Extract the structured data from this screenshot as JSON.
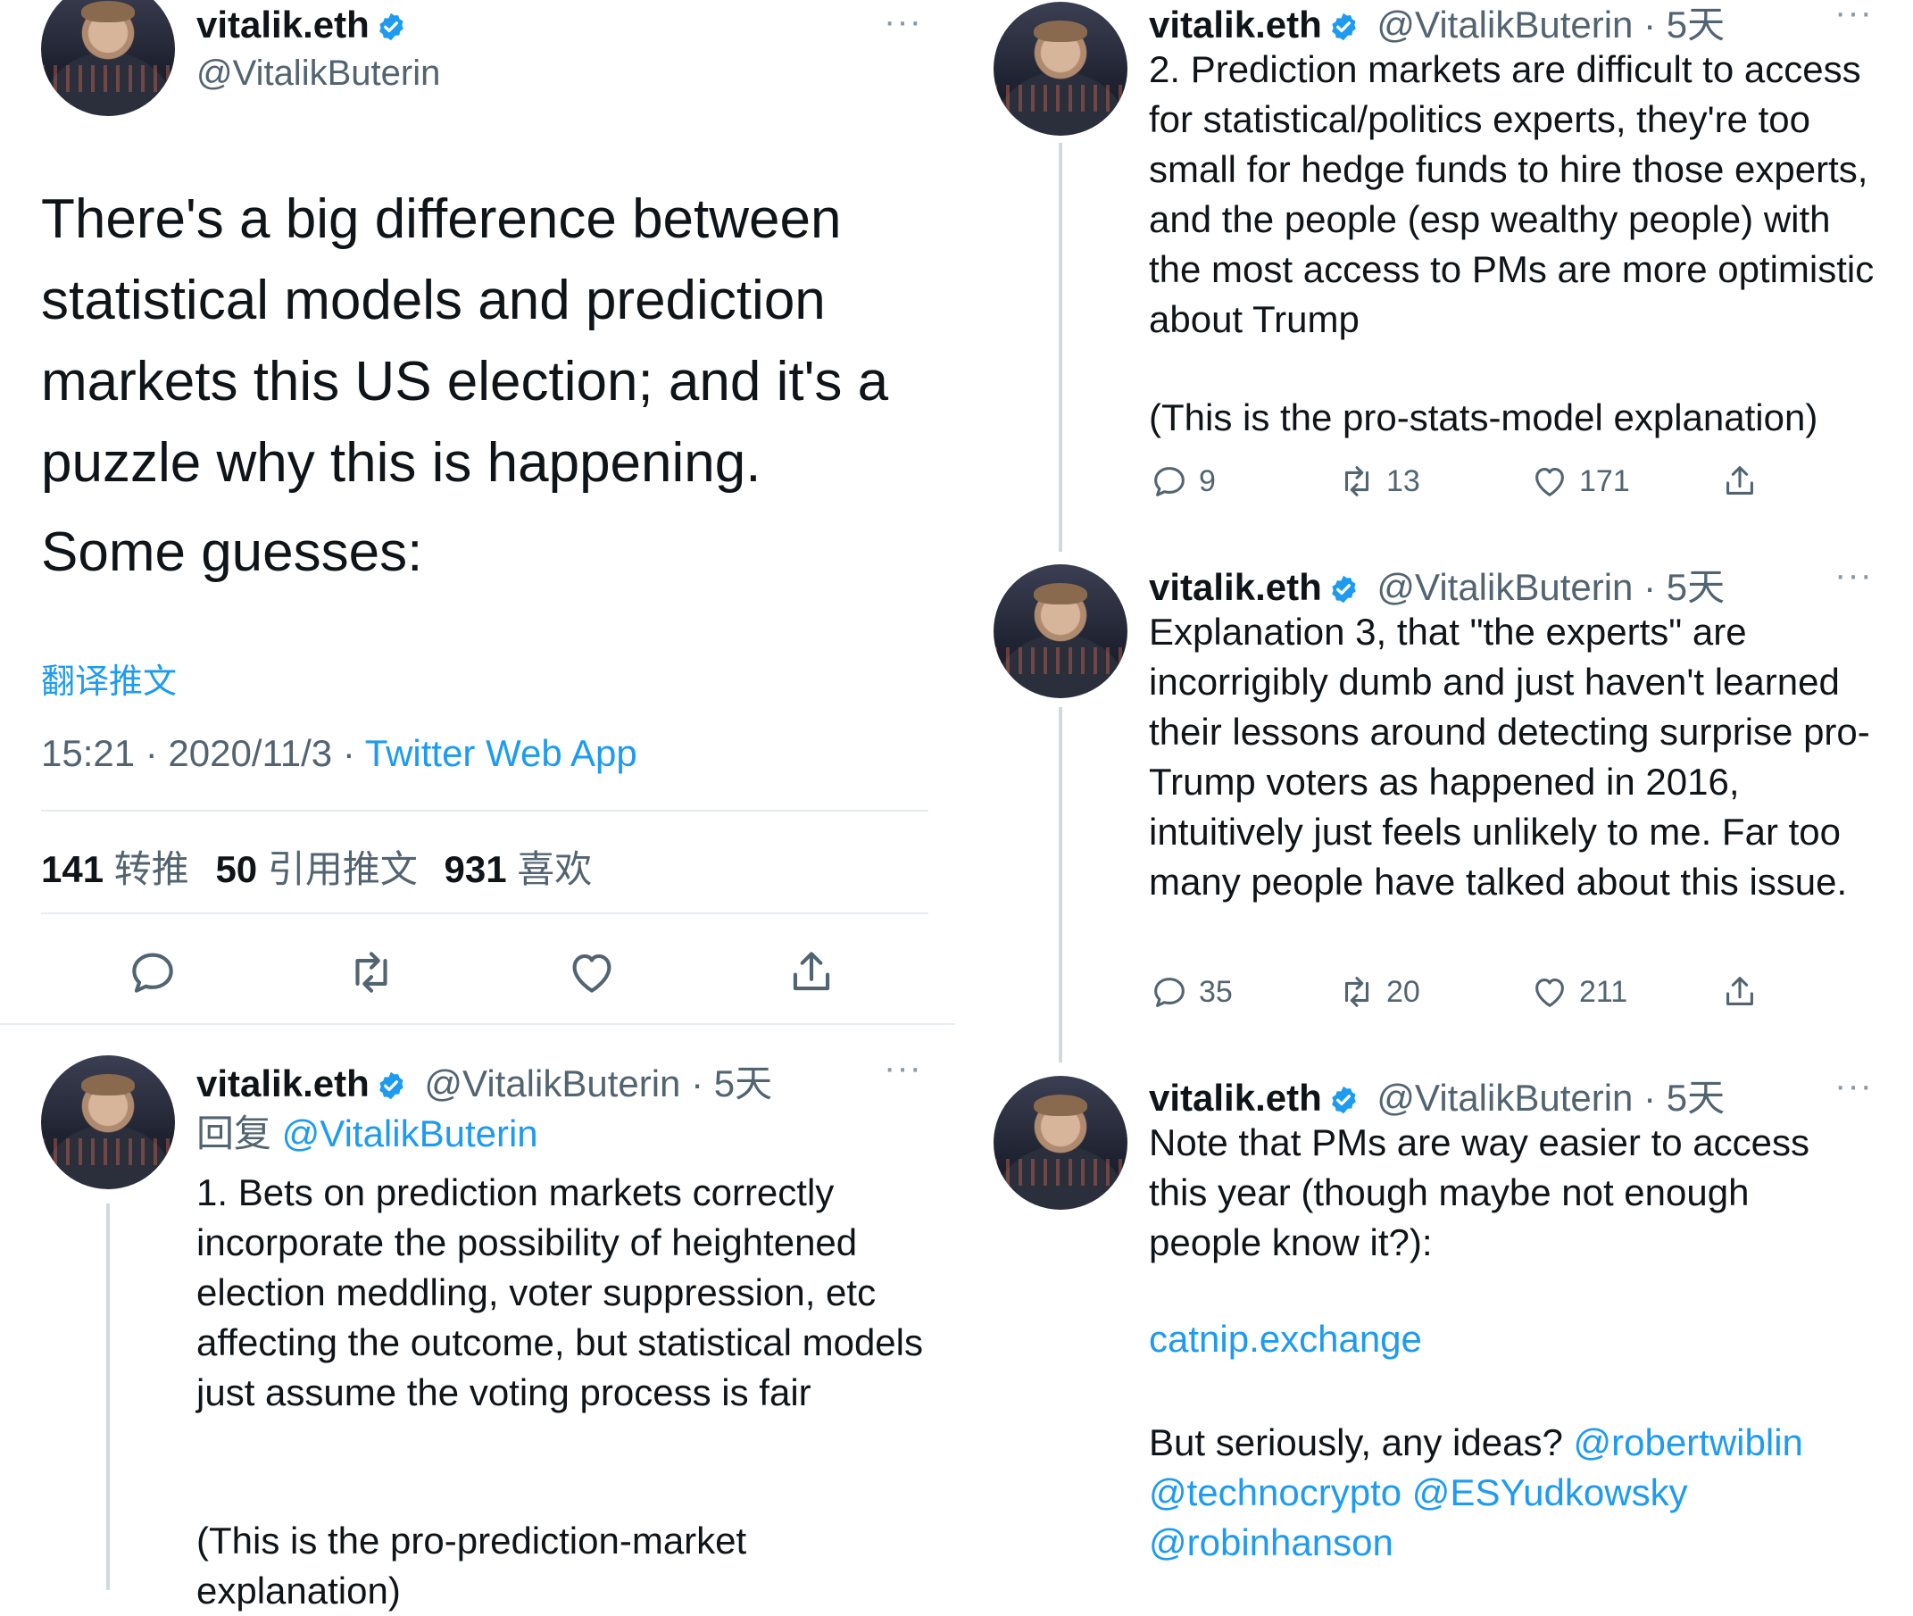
{
  "main": {
    "name": "vitalik.eth",
    "handle": "@VitalikButerin",
    "more": "···",
    "text": "There's a big difference between statistical models and prediction markets this US election; and it's a puzzle why this is happening.",
    "text2": "Some guesses:",
    "translate": "翻译推文",
    "time": "15:21 · 2020/11/3 · ",
    "source": "Twitter Web App",
    "retweets_count": "141",
    "retweets_label": "转推",
    "quotes_count": "50",
    "quotes_label": "引用推文",
    "likes_count": "931",
    "likes_label": "喜欢"
  },
  "reply1": {
    "name": "vitalik.eth",
    "handle": "@VitalikButerin · 5天",
    "more": "···",
    "reply_prefix": "回复 ",
    "reply_to": "@VitalikButerin",
    "text": "1. Bets on prediction markets correctly incorporate the possibility of heightened election meddling, voter suppression, etc affecting the outcome, but statistical models just assume the voting process is fair",
    "text2": "(This is the pro-prediction-market explanation)"
  },
  "right": [
    {
      "name": "vitalik.eth",
      "handle": "@VitalikButerin · 5天",
      "more": "···",
      "text": "2. Prediction markets are difficult to access for statistical/politics experts, they're too small for hedge funds to hire those experts, and the people (esp wealthy people) with the most access to PMs are more optimistic about Trump",
      "text2": "(This is the pro-stats-model explanation)",
      "replies": "9",
      "retweets": "13",
      "likes": "171"
    },
    {
      "name": "vitalik.eth",
      "handle": "@VitalikButerin · 5天",
      "more": "···",
      "text": "Explanation 3, that \"the experts\" are incorrigibly dumb and just haven't learned their lessons around detecting surprise pro-Trump voters as happened in 2016, intuitively just feels unlikely to me. Far too many people have talked about this issue.",
      "replies": "35",
      "retweets": "20",
      "likes": "211"
    },
    {
      "name": "vitalik.eth",
      "handle": "@VitalikButerin · 5天",
      "more": "···",
      "text": "Note that PMs are way easier to access this year (though maybe not enough people know it?):",
      "link": "catnip.exchange",
      "text3": "But seriously, any ideas? ",
      "mentions": [
        "@robertwiblin",
        "@technocrypto",
        "@ESYudkowsky",
        "@robinhanson"
      ]
    }
  ],
  "colors": {
    "accent": "#1d9bf0",
    "muted": "#536471",
    "border": "#e6ecf0"
  },
  "icons": [
    "reply-icon",
    "retweet-icon",
    "like-icon",
    "share-icon",
    "verified-icon",
    "more-icon"
  ]
}
